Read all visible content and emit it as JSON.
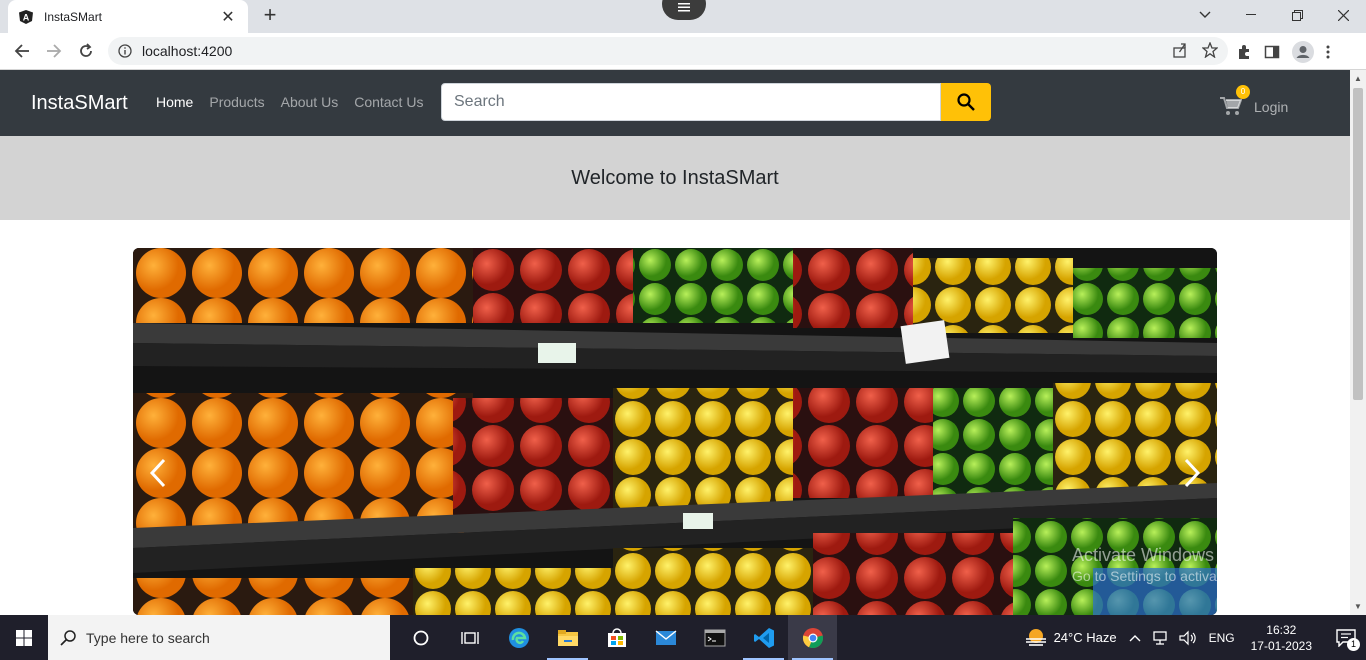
{
  "browser": {
    "tab_title": "InstaSMart",
    "url": "localhost:4200"
  },
  "site": {
    "brand": "InstaSMart",
    "nav": [
      {
        "label": "Home",
        "active": true
      },
      {
        "label": "Products",
        "active": false
      },
      {
        "label": "About Us",
        "active": false
      },
      {
        "label": "Contact Us",
        "active": false
      }
    ],
    "search_placeholder": "Search",
    "cart_count": "0",
    "login_label": "Login",
    "welcome_text": "Welcome to InstaSMart",
    "carousel_prev": "‹",
    "carousel_next": "›",
    "accent": "#ffc107",
    "navbar_bg": "#343a40"
  },
  "watermark": {
    "line1": "Activate Windows",
    "line2": "Go to Settings to activate Windows."
  },
  "taskbar": {
    "search_placeholder": "Type here to search",
    "weather": "24°C  Haze",
    "language": "ENG",
    "time": "16:32",
    "date": "17-01-2023",
    "notification_count": "1"
  }
}
